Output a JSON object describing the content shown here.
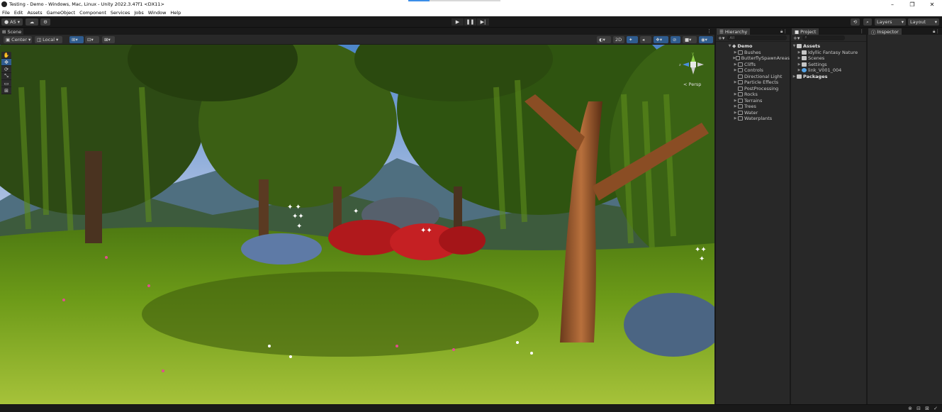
{
  "window": {
    "title": "Testing - Demo - Windows, Mac, Linux - Unity 2022.3.47f1 <DX11>",
    "progress_fraction": 0.23,
    "controls": [
      "–",
      "❐",
      "✕"
    ]
  },
  "menu": [
    "File",
    "Edit",
    "Assets",
    "GameObject",
    "Component",
    "Services",
    "Jobs",
    "Window",
    "Help"
  ],
  "toolbar": {
    "account": "AS ▾",
    "cloud_icon": "cloud-icon",
    "collab_icon": "collab-icon",
    "play_icon": "▶",
    "pause_icon": "❚❚",
    "step_icon": "▶|",
    "history_icon": "history-icon",
    "search_icon": "search-icon",
    "layers_label": "Layers",
    "layout_label": "Layout"
  },
  "scene": {
    "tab_label": "Scene",
    "pivot_label": "Center",
    "space_label": "Local",
    "mode_2d": "2D",
    "persp_label": "< Persp",
    "tools": [
      "✋",
      "✥",
      "⟳",
      "⤡",
      "▭",
      "⊞"
    ]
  },
  "hierarchy": {
    "tab_label": "Hierarchy",
    "search_placeholder": "All",
    "root": "Demo",
    "items": [
      "Bushes",
      "ButterflySpawnAreas",
      "Cliffs",
      "Controls",
      "Directional Light",
      "Particle Effects",
      "PostProcessing",
      "Rocks",
      "Terrains",
      "Trees",
      "Water",
      "Waterplants"
    ],
    "expandable": [
      true,
      true,
      true,
      true,
      false,
      true,
      false,
      true,
      true,
      true,
      true,
      true
    ]
  },
  "project": {
    "tab_label": "Project",
    "assets_label": "Assets",
    "asset_items": [
      "Idyllic Fantasy Nature",
      "Scenes",
      "Settings",
      "link_V001_004"
    ],
    "packages_label": "Packages"
  },
  "inspector": {
    "tab_label": "Inspector"
  }
}
